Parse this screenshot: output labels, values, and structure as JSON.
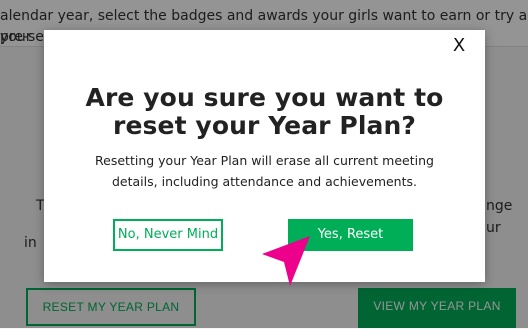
{
  "background": {
    "intro_line1": "alendar year, select the badges and awards your girls want to earn or try a pre-selected",
    "intro_line2": "your",
    "left_fragment1": "T",
    "left_fragment2": "in",
    "right_fragment1": "nge",
    "right_fragment2": "ur",
    "reset_button": "RESET MY YEAR PLAN",
    "view_button": "VIEW MY YEAR PLAN"
  },
  "modal": {
    "close_label": "X",
    "title_line1": "Are you sure you want to",
    "title_line2": "reset your Year Plan?",
    "body_line1": "Resetting your Year Plan will erase all current meeting",
    "body_line2": "details, including attendance and achievements.",
    "cancel_label": "No, Never Mind",
    "confirm_label": "Yes, Reset"
  },
  "colors": {
    "brand_green": "#00ae58",
    "pointer_pink": "#ec008c",
    "overlay": "rgba(0,0,0,0.42)"
  },
  "icons": {
    "pointer": "arrow-pointer-icon",
    "close": "close-icon"
  }
}
